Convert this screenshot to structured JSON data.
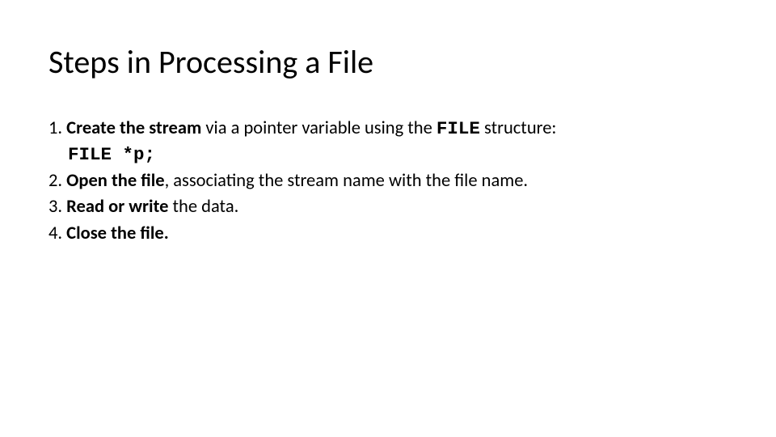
{
  "title": "Steps in Processing a File",
  "body": {
    "item1": {
      "num": "1. ",
      "bold": "Create the stream",
      "rest1": " via a pointer variable using the ",
      "code": "FILE",
      "rest2": " structure:",
      "code_line": "FILE *p;"
    },
    "item2": {
      "num": "2. ",
      "bold": "Open the file",
      "rest": ", associating the stream name with the file name."
    },
    "item3": {
      "num": "3. ",
      "bold": "Read or write",
      "rest": " the data."
    },
    "item4": {
      "num": "4. ",
      "bold": "Close the file."
    }
  }
}
